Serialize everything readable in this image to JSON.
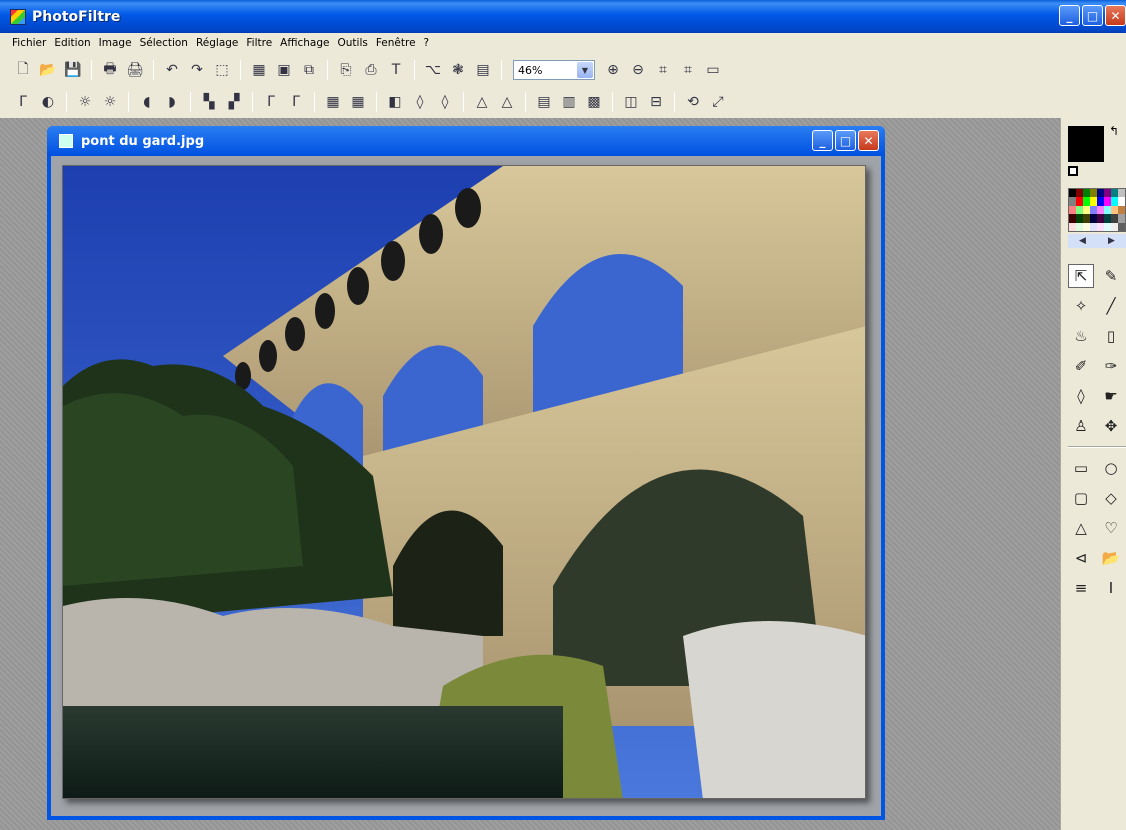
{
  "app": {
    "title": "PhotoFiltre"
  },
  "window_controls": {
    "minimize": "_",
    "maximize": "□",
    "close": "✕"
  },
  "menu": [
    "Fichier",
    "Edition",
    "Image",
    "Sélection",
    "Réglage",
    "Filtre",
    "Affichage",
    "Outils",
    "Fenêtre",
    "?"
  ],
  "toolbar1": {
    "icons": [
      "new-icon",
      "open-icon",
      "save-icon",
      "print-icon",
      "scan-icon",
      "undo-icon",
      "redo-icon",
      "crop-icon",
      "grayscale-icon",
      "rgb-icon",
      "layer-icon",
      "text-mask-icon",
      "text-mask2-icon",
      "text-icon",
      "explorer-icon",
      "plugin-icon",
      "frame-icon"
    ],
    "glyphs": [
      "🗋",
      "📂",
      "💾",
      "🖶",
      "🖨",
      "↶",
      "↷",
      "⬚",
      "▦",
      "▣",
      "⧉",
      "⎘",
      "⎙",
      "T",
      "⌥",
      "❃",
      "▤"
    ],
    "zoom_value": "46%",
    "zoom_icons": [
      "zoom-in-icon",
      "zoom-out-icon",
      "fit-icon",
      "fullsize-icon",
      "slideshow-icon"
    ],
    "zoom_glyphs": [
      "⊕",
      "⊖",
      "⌗",
      "⌗",
      "▭"
    ]
  },
  "toolbar2": {
    "icons": [
      "auto-levels-icon",
      "auto-contrast-icon",
      "brightness-minus-icon",
      "brightness-plus-icon",
      "contrast-minus-icon",
      "contrast-plus-icon",
      "saturation-minus-icon",
      "saturation-plus-icon",
      "gamma-minus-icon",
      "gamma-plus-icon",
      "grid-icon",
      "tile-icon",
      "blur-icon",
      "drop-icon",
      "sharpen-icon",
      "triangle-icon",
      "sharpen-more-icon",
      "gradient-icon",
      "fade-icon",
      "texture-icon",
      "flip-horizontal-icon",
      "flip-vertical-icon",
      "rotate-icon",
      "resize-icon"
    ],
    "glyphs": [
      "Γ",
      "◐",
      "☼",
      "☼",
      "◖",
      "◗",
      "▚",
      "▞",
      "Γ",
      "Γ",
      "▦",
      "▦",
      "◧",
      "◊",
      "◊",
      "△",
      "△",
      "▤",
      "▥",
      "▩",
      "◫",
      "⊟",
      "⟲",
      "⤢"
    ]
  },
  "document": {
    "title": "pont du gard.jpg",
    "image_alt": "Photograph of the Pont du Gard aqueduct"
  },
  "right_panel": {
    "foreground_color": "#000000",
    "background_color": "#ffffff",
    "swap_glyph": "↰",
    "palette_colors": [
      "#000000",
      "#800000",
      "#008000",
      "#808000",
      "#000080",
      "#800080",
      "#008080",
      "#c0c0c0",
      "#808080",
      "#ff0000",
      "#00ff00",
      "#ffff00",
      "#0000ff",
      "#ff00ff",
      "#00ffff",
      "#ffffff",
      "#ff8080",
      "#80ff80",
      "#ffff80",
      "#8080ff",
      "#ff80ff",
      "#80ffff",
      "#ffc080",
      "#c08040",
      "#400000",
      "#004000",
      "#404000",
      "#000040",
      "#400040",
      "#004040",
      "#404040",
      "#a0a0a0",
      "#ffe0e0",
      "#e0ffe0",
      "#ffffe0",
      "#e0e0ff",
      "#ffe0ff",
      "#e0ffff",
      "#f0f0f0",
      "#606060"
    ],
    "palette_nav": [
      "◀",
      "▶"
    ],
    "tools": [
      {
        "name": "select-arrow-icon",
        "glyph": "⇱",
        "active": true
      },
      {
        "name": "eyedropper-icon",
        "glyph": "✎"
      },
      {
        "name": "magic-wand-icon",
        "glyph": "✧"
      },
      {
        "name": "line-icon",
        "glyph": "╱"
      },
      {
        "name": "fill-bucket-icon",
        "glyph": "♨"
      },
      {
        "name": "spray-icon",
        "glyph": "▯"
      },
      {
        "name": "brush-icon",
        "glyph": "✐"
      },
      {
        "name": "advanced-brush-icon",
        "glyph": "✑"
      },
      {
        "name": "blur-drop-icon",
        "glyph": "◊"
      },
      {
        "name": "smudge-icon",
        "glyph": "☛"
      },
      {
        "name": "stamp-icon",
        "glyph": "♙"
      },
      {
        "name": "move-icon",
        "glyph": "✥"
      }
    ],
    "shapes": [
      {
        "name": "rectangle-icon",
        "glyph": "▭"
      },
      {
        "name": "ellipse-icon",
        "glyph": "○"
      },
      {
        "name": "rounded-rect-icon",
        "glyph": "▢"
      },
      {
        "name": "diamond-icon",
        "glyph": "◇"
      },
      {
        "name": "triangle-shape-icon",
        "glyph": "△"
      },
      {
        "name": "lasso-icon",
        "glyph": "♡"
      },
      {
        "name": "polygon-icon",
        "glyph": "⊲"
      },
      {
        "name": "open-shape-icon",
        "glyph": "📂"
      },
      {
        "name": "select-all-icon",
        "glyph": "≡"
      },
      {
        "name": "text-cursor-icon",
        "glyph": "I"
      }
    ]
  }
}
